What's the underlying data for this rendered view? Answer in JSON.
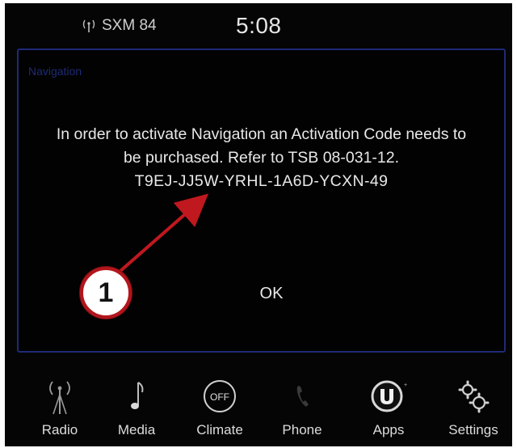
{
  "status": {
    "radio_source": "SXM 84",
    "time": "5:08"
  },
  "dialog": {
    "title": "Navigation",
    "message_line1": "In order to activate Navigation an Activation Code needs to",
    "message_line2": "be purchased. Refer to TSB 08-031-12.",
    "activation_code": "T9EJ-JJ5W-YRHL-1A6D-YCXN-49",
    "ok_label": "OK"
  },
  "callout": {
    "number": "1",
    "color": "#b2161d"
  },
  "nav": {
    "items": [
      {
        "label": "Radio",
        "icon": "radio-icon"
      },
      {
        "label": "Media",
        "icon": "music-note-icon"
      },
      {
        "label": "Climate",
        "icon": "climate-off-icon",
        "icon_text": "OFF"
      },
      {
        "label": "Phone",
        "icon": "phone-icon"
      },
      {
        "label": "Apps",
        "icon": "uconnect-apps-icon"
      },
      {
        "label": "Settings",
        "icon": "gears-icon"
      }
    ]
  }
}
